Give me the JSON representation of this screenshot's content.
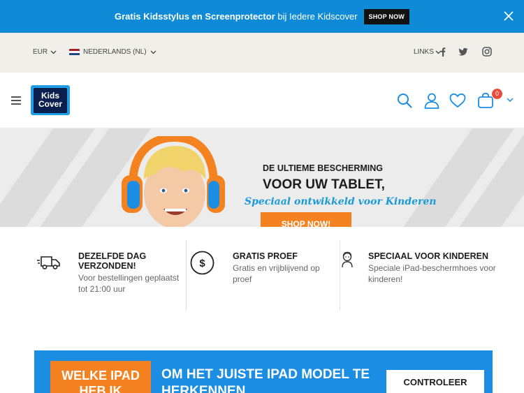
{
  "promo": {
    "bold_text": "Gratis Kidsstylus en Screenprotector",
    "normal_text": " bij Iedere Kidscover",
    "button_label": "SHOP NOW"
  },
  "utility": {
    "currency": "EUR",
    "language": "NEDERLANDS (NL)",
    "links_label": "LINKS",
    "flag_colors": [
      "#ae1c28",
      "#ffffff",
      "#21468b"
    ]
  },
  "header": {
    "logo_line1": "Kids",
    "logo_line2": "Cover",
    "cart_count": "0",
    "icons": [
      "menu-icon",
      "search-icon",
      "user-icon",
      "heart-icon",
      "cart-icon",
      "chevron-down-icon"
    ]
  },
  "hero": {
    "title1": "DE ULTIEME BESCHERMING",
    "title2": "VOOR UW TABLET,",
    "subtitle": "Speciaal ontwikkeld voor Kinderen",
    "button_label": "SHOP NOW!"
  },
  "features": [
    {
      "title": "DEZELFDE DAG VERZONDEN!",
      "desc": "Voor bestellingen geplaatst tot 21:00 uur",
      "icon": "truck-icon"
    },
    {
      "title": "GRATIS PROEF",
      "desc": "Gratis en vrijblijvend op proef",
      "icon": "dollar-circle-icon"
    },
    {
      "title": "SPECIAAL VOOR KINDEREN",
      "desc": "Speciale iPad-beschermhoes voor kinderen!",
      "icon": "child-icon"
    }
  ],
  "banner": {
    "orange_text": "WELKE IPAD HEB IK",
    "main_text": "OM HET JUISTE IPAD MODEL TE HERKENNEN",
    "button_label": "CONTROLEER"
  },
  "colors": {
    "promo_bg": "#0f8ad6",
    "accent_blue": "#1b8ee3",
    "accent_orange": "#f58220",
    "badge_red": "#e84c3d"
  }
}
